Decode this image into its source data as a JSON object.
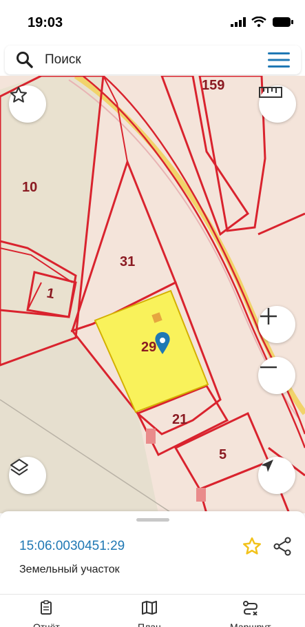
{
  "status_bar": {
    "time": "19:03",
    "icons": [
      "signal-icon",
      "wifi-icon",
      "battery-icon"
    ]
  },
  "search": {
    "placeholder": "Поиск"
  },
  "map": {
    "parcel_labels": [
      "159",
      "10",
      "31",
      "1",
      "29",
      "21",
      "5"
    ],
    "highlight_color": "#f9f25b",
    "boundary_color": "#d9232e"
  },
  "controls": [
    "favorite-star-icon",
    "ruler-icon",
    "zoom-in-icon",
    "zoom-out-icon",
    "layers-icon",
    "location-arrow-icon"
  ],
  "sheet": {
    "cadastral_number": "15:06:0030451:29",
    "object_type": "Земельный участок"
  },
  "tabs": [
    {
      "label": "Отчёт",
      "icon": "report-icon"
    },
    {
      "label": "План",
      "icon": "map-plan-icon"
    },
    {
      "label": "Маршрут",
      "icon": "route-icon"
    }
  ],
  "colors": {
    "accent": "#1f78b4",
    "star": "#f2c21b"
  }
}
